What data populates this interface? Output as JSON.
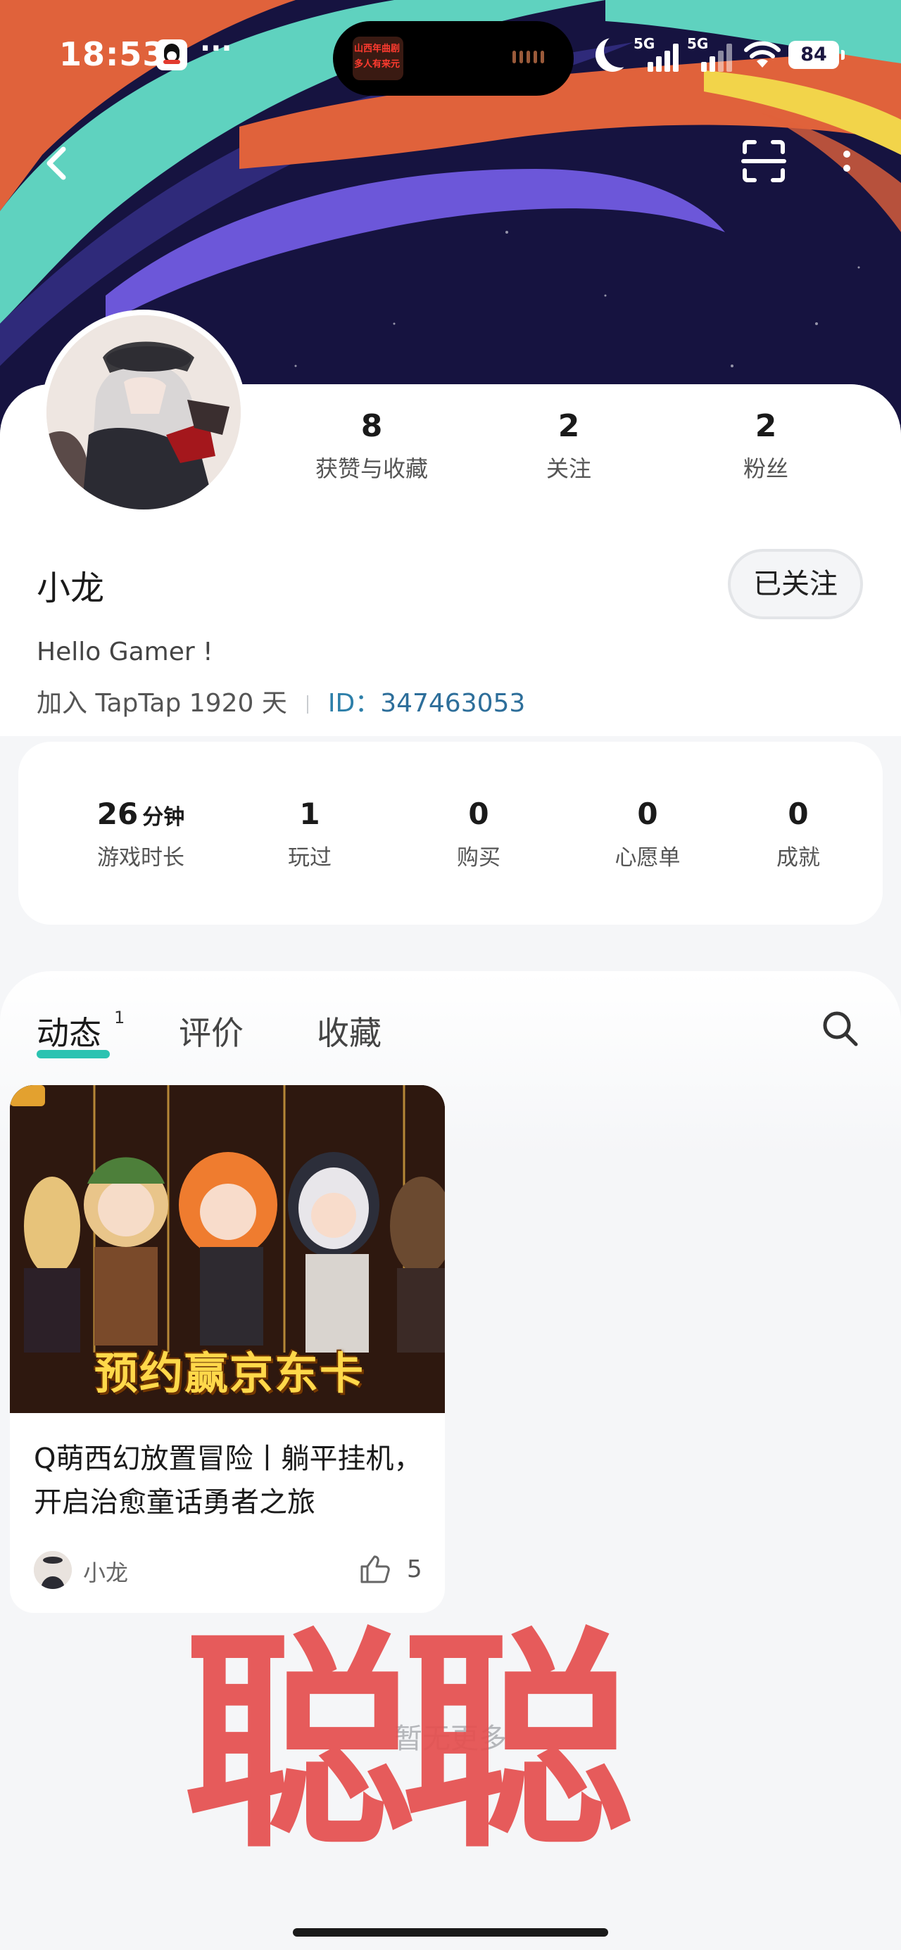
{
  "status_bar": {
    "time": "18:53",
    "overflow": "···",
    "live_activity_line1": "山西年曲剧",
    "live_activity_line2": "多人有来元",
    "network_1": "5G",
    "network_2": "5G",
    "battery": "84",
    "icons": [
      "qq-icon",
      "moon-icon",
      "signal-icon",
      "wifi-icon",
      "battery-icon"
    ]
  },
  "header": {
    "icons": [
      "back-icon",
      "scan-icon",
      "more-icon"
    ]
  },
  "profile": {
    "name": "小龙",
    "follow_button": "已关注",
    "bio": "Hello Gamer !",
    "join_text": "加入 TapTap 1920 天",
    "id_label": "ID：",
    "id_value": "347463053",
    "stats": [
      {
        "value": "8",
        "label": "获赞与收藏"
      },
      {
        "value": "2",
        "label": "关注"
      },
      {
        "value": "2",
        "label": "粉丝"
      }
    ]
  },
  "game_stats": [
    {
      "value": "26",
      "unit": "分钟",
      "label": "游戏时长"
    },
    {
      "value": "1",
      "unit": "",
      "label": "玩过"
    },
    {
      "value": "0",
      "unit": "",
      "label": "购买"
    },
    {
      "value": "0",
      "unit": "",
      "label": "心愿单"
    },
    {
      "value": "0",
      "unit": "",
      "label": "成就"
    }
  ],
  "tabs": {
    "items": [
      "动态",
      "评价",
      "收藏"
    ],
    "active": "动态",
    "badge": "1"
  },
  "post": {
    "image_banner_text": "预约赢京东卡",
    "title": "Q萌西幻放置冒险丨躺平挂机，开启治愈童话勇者之旅",
    "author": "小龙",
    "likes": "5"
  },
  "feed_footer": "暂无更多",
  "watermark": "聪聪",
  "colors": {
    "accent": "#2bc3b1",
    "link": "#2d7fa9",
    "watermark": "#e55050",
    "banner_bg": "#14123f"
  }
}
